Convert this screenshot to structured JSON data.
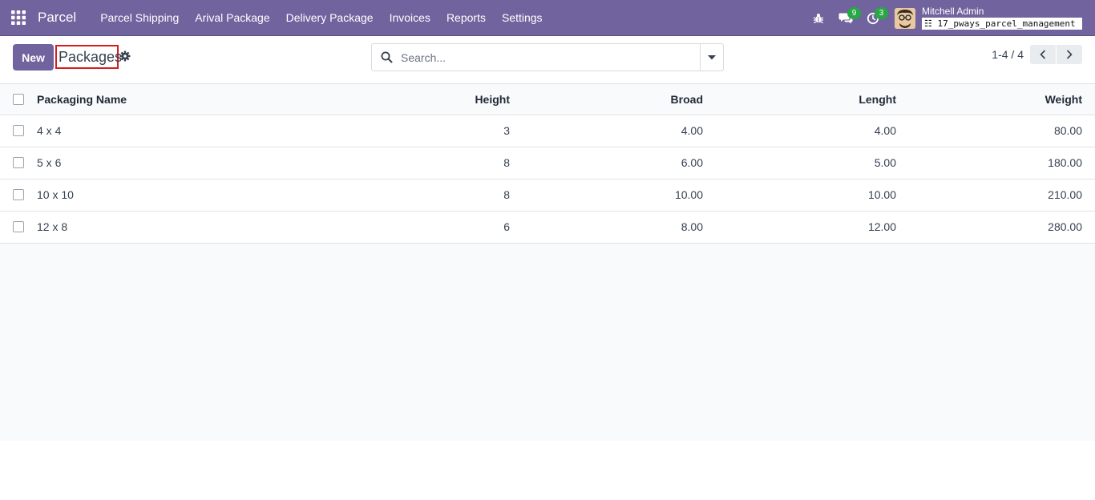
{
  "navbar": {
    "brand": "Parcel",
    "menu": [
      "Parcel Shipping",
      "Arival Package",
      "Delivery Package",
      "Invoices",
      "Reports",
      "Settings"
    ],
    "messages_count": "9",
    "activities_count": "3",
    "user_name": "Mitchell Admin",
    "database": "17_pways_parcel_management"
  },
  "control": {
    "new_label": "New",
    "title": "Packages",
    "search_placeholder": "Search...",
    "pager": "1-4 / 4"
  },
  "table": {
    "headers": {
      "name": "Packaging Name",
      "height": "Height",
      "broad": "Broad",
      "length": "Lenght",
      "weight": "Weight"
    },
    "rows": [
      {
        "name": "4 x 4",
        "height": "3",
        "broad": "4.00",
        "length": "4.00",
        "weight": "80.00"
      },
      {
        "name": "5 x 6",
        "height": "8",
        "broad": "6.00",
        "length": "5.00",
        "weight": "180.00"
      },
      {
        "name": "10 x 10",
        "height": "8",
        "broad": "10.00",
        "length": "10.00",
        "weight": "210.00"
      },
      {
        "name": "12 x 8",
        "height": "6",
        "broad": "8.00",
        "length": "12.00",
        "weight": "280.00"
      }
    ]
  },
  "colors": {
    "brand": "#71639e",
    "badge": "#28a745",
    "highlight_border": "#d61d1d"
  }
}
